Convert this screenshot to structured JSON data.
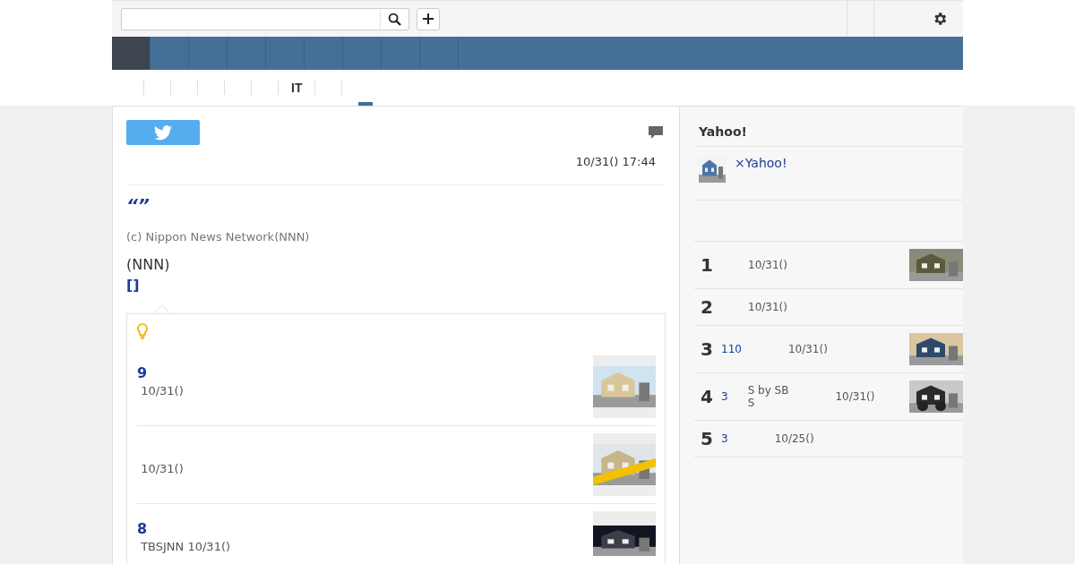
{
  "nav": {
    "tabs": [
      {
        "selected": true
      },
      {
        "selected": false
      },
      {
        "selected": false
      },
      {
        "selected": false
      },
      {
        "selected": false
      },
      {
        "selected": false
      },
      {
        "selected": false
      },
      {
        "selected": false
      },
      {
        "selected": false
      }
    ]
  },
  "subnav": {
    "items": [
      {
        "kind": "blank"
      },
      {
        "kind": "blank"
      },
      {
        "kind": "blank"
      },
      {
        "kind": "blank"
      },
      {
        "kind": "blank"
      },
      {
        "kind": "text",
        "label": "IT"
      },
      {
        "kind": "blank"
      },
      {
        "kind": "blank"
      }
    ]
  },
  "article": {
    "date": "10/31() 17:44",
    "headline": "“”",
    "credit": "(c) Nippon News Network(NNN)",
    "body": "(NNN)",
    "link": "[]",
    "related": [
      {
        "title": "9",
        "meta": "10/31()"
      },
      {
        "meta": "10/31()"
      },
      {
        "title": "8",
        "meta": "TBSJNN 10/31()"
      }
    ]
  },
  "sidebar": {
    "heading": "Yahoo!",
    "promo": "×Yahoo!",
    "ranking": [
      {
        "rank": "1",
        "date": "10/31()"
      },
      {
        "rank": "2",
        "date": "10/31()"
      },
      {
        "rank": "3",
        "title": "110",
        "date": "10/31()"
      },
      {
        "rank": "4",
        "title": "3",
        "source": "S by SB\nS",
        "date": "10/31()"
      },
      {
        "rank": "5",
        "title": "3",
        "date": "10/25()"
      }
    ]
  }
}
